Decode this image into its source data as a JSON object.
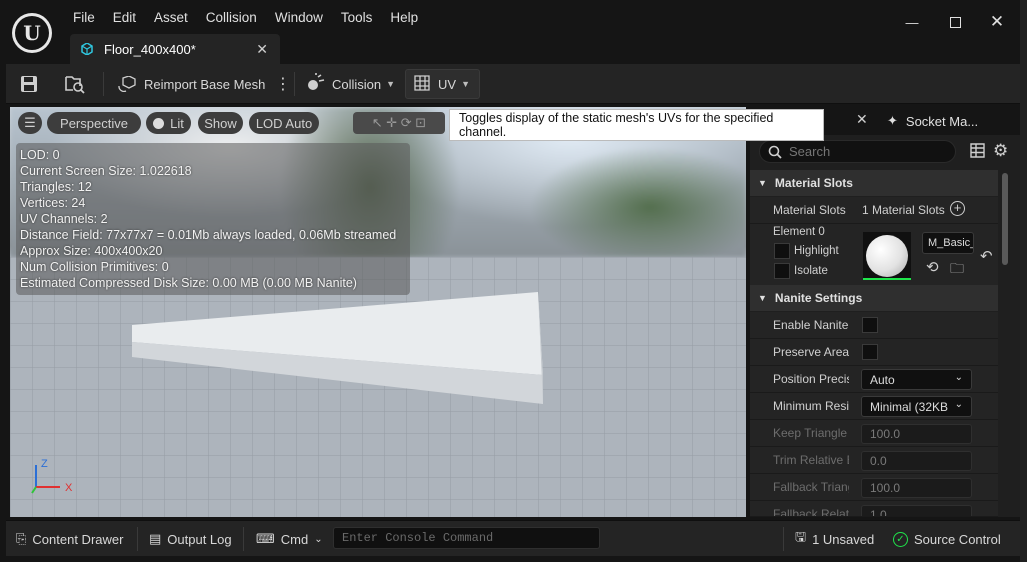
{
  "window": {
    "tab_title": "Floor_400x400*"
  },
  "menu": [
    "File",
    "Edit",
    "Asset",
    "Collision",
    "Window",
    "Tools",
    "Help"
  ],
  "toolbar": {
    "reimport_label": "Reimport Base Mesh",
    "collision_label": "Collision",
    "uv_label": "UV",
    "uv_tooltip": "Toggles display of the static mesh's UVs for the specified channel."
  },
  "viewport": {
    "perspective_label": "Perspective",
    "lit_label": "Lit",
    "show_label": "Show",
    "lod_label": "LOD Auto",
    "info_lines": [
      "LOD:  0",
      "Current Screen Size:  1.022618",
      "Triangles:  12",
      "Vertices:  24",
      "UV Channels:  2",
      "Distance Field:  77x77x7 = 0.01Mb always loaded, 0.06Mb streamed",
      "Approx Size: 400x400x20",
      "Num Collision Primitives:  0",
      "Estimated Compressed Disk Size: 0.00 MB (0.00 MB Nanite)"
    ],
    "axis_z": "Z",
    "axis_x": "X"
  },
  "panel": {
    "socket_tab": "Socket Ma...",
    "search_placeholder": "Search",
    "material_slots_header": "Material Slots",
    "material_slots_label": "Material Slots",
    "material_slots_count": "1 Material Slots",
    "element_label": "Element 0",
    "highlight_label": "Highlight",
    "isolate_label": "Isolate",
    "material_name": "M_Basic_",
    "nanite_header": "Nanite Settings",
    "rows": [
      {
        "label": "Enable Nanite S",
        "type": "check"
      },
      {
        "label": "Preserve Area",
        "type": "check"
      },
      {
        "label": "Position Precis",
        "type": "dropdown",
        "value": "Auto"
      },
      {
        "label": "Minimum Resid",
        "type": "dropdown",
        "value": "Minimal (32KB)"
      },
      {
        "label": "Keep Triangle P",
        "type": "number",
        "value": "100.0",
        "dim": true
      },
      {
        "label": "Trim Relative E",
        "type": "number",
        "value": "0.0",
        "dim": true
      },
      {
        "label": "Fallback Triang",
        "type": "number",
        "value": "100.0",
        "dim": true
      },
      {
        "label": "Fallback Relativ",
        "type": "number",
        "value": "1.0",
        "dim": true
      }
    ]
  },
  "status": {
    "content_drawer": "Content Drawer",
    "output_log": "Output Log",
    "cmd_label": "Cmd",
    "console_placeholder": "Enter Console Command",
    "unsaved": "1 Unsaved",
    "source_control": "Source Control"
  },
  "colors": {
    "accent": "#26bbff",
    "success": "#1fe44b"
  }
}
